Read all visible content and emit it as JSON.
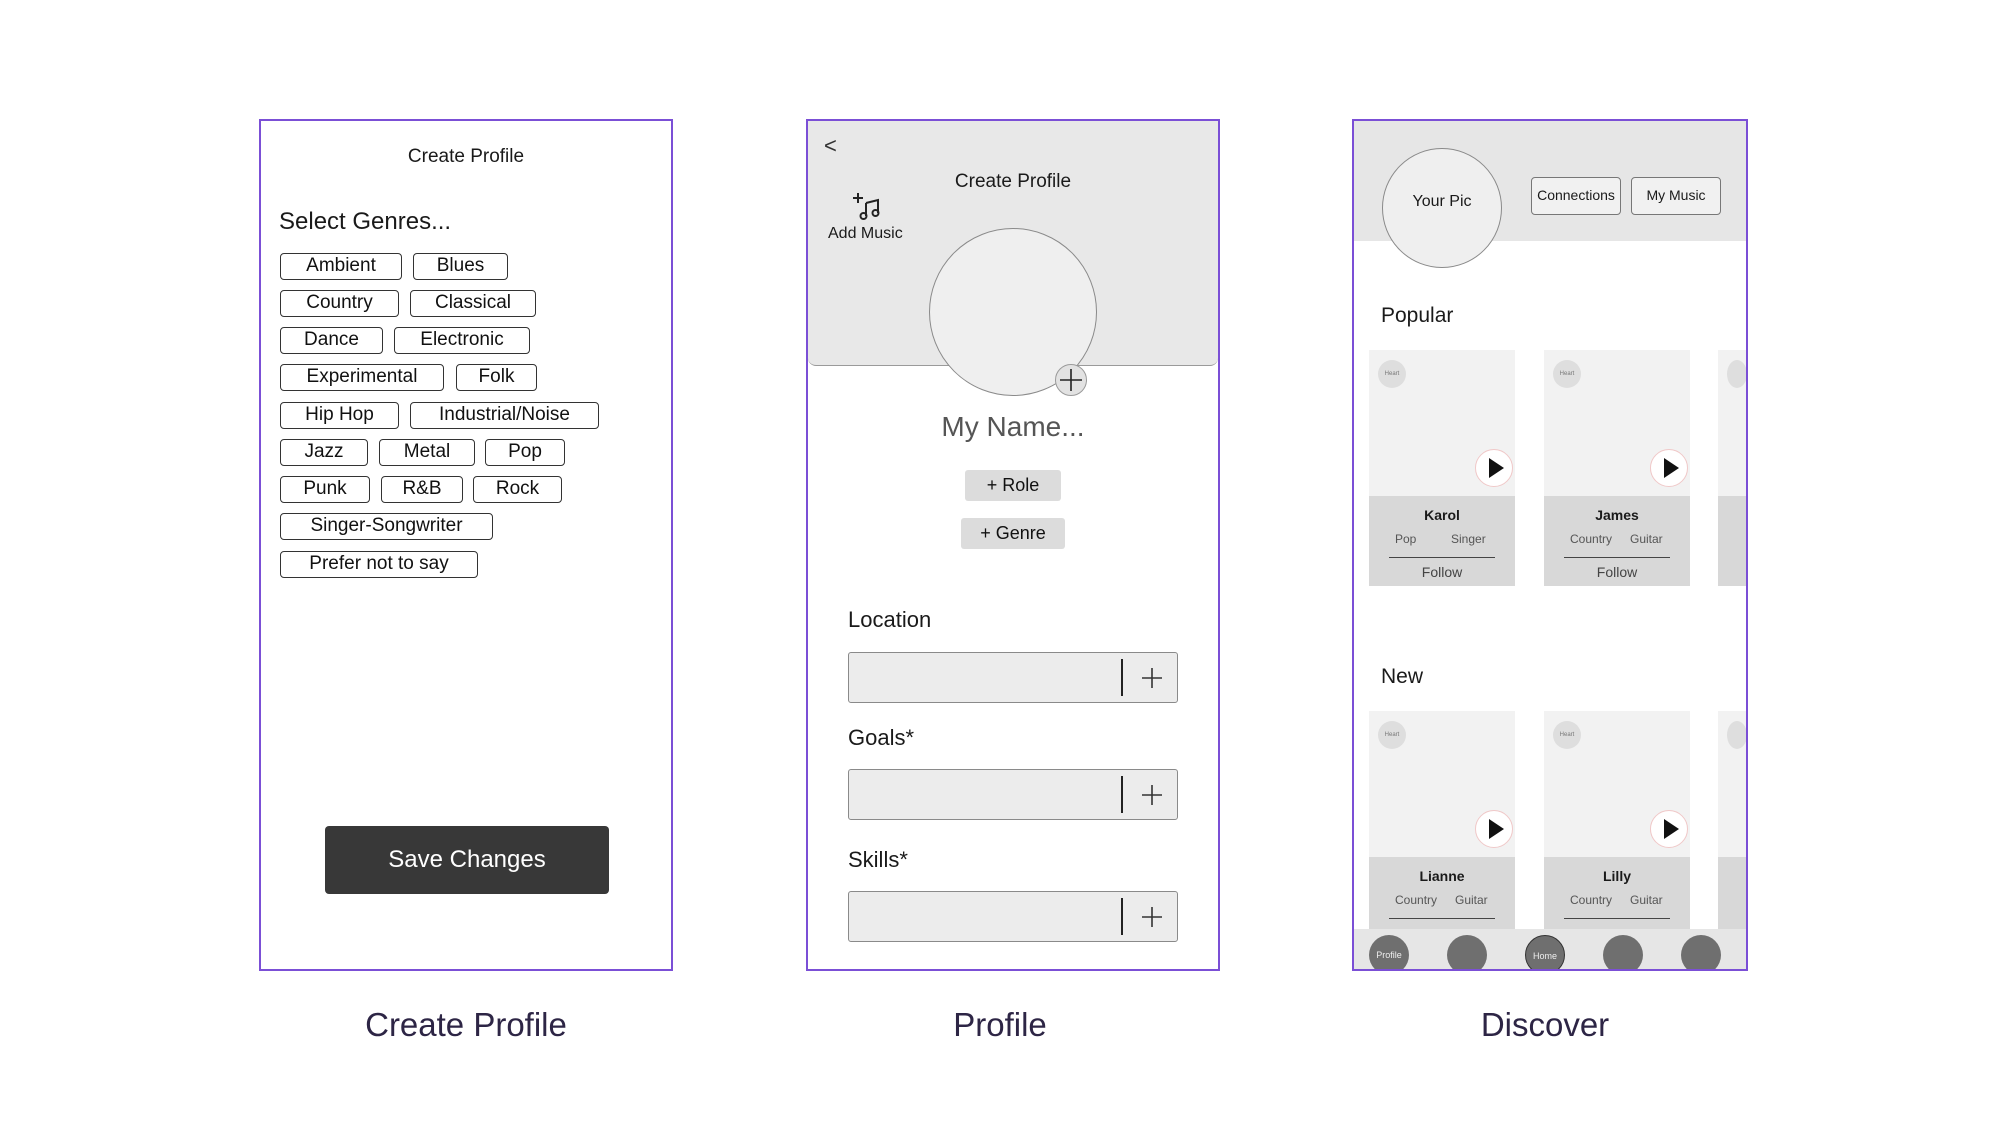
{
  "create_profile": {
    "title": "Create Profile",
    "heading": "Select Genres...",
    "genres": [
      "Ambient",
      "Blues",
      "Country",
      "Classical",
      "Dance",
      "Electronic",
      "Experimental",
      "Folk",
      "Hip Hop",
      "Industrial/Noise",
      "Jazz",
      "Metal",
      "Pop",
      "Punk",
      "R&B",
      "Rock",
      "Singer-Songwriter",
      "Prefer not to say"
    ],
    "save_label": "Save Changes",
    "caption": "Create Profile"
  },
  "profile": {
    "title": "Create Profile",
    "back_label": "<",
    "add_music_label": "Add Music",
    "name_placeholder": "My Name...",
    "role_label": "+ Role",
    "genre_label": "+ Genre",
    "fields": [
      "Location",
      "Goals*",
      "Skills*"
    ],
    "caption": "Profile"
  },
  "discover": {
    "your_pic": "Your Pic",
    "connections_label": "Connections",
    "my_music_label": "My Music",
    "popular_label": "Popular",
    "new_label": "New",
    "heart_label": "Heart",
    "follow_label": "Follow",
    "popular_cards": [
      {
        "name": "Karol",
        "genre": "Pop",
        "role": "Singer"
      },
      {
        "name": "James",
        "genre": "Country",
        "role": "Guitar"
      }
    ],
    "new_cards": [
      {
        "name": "Lianne",
        "genre": "Country",
        "role": "Guitar"
      },
      {
        "name": "Lilly",
        "genre": "Country",
        "role": "Guitar"
      }
    ],
    "nav": {
      "profile": "Profile",
      "home": "Home"
    },
    "caption": "Discover"
  }
}
